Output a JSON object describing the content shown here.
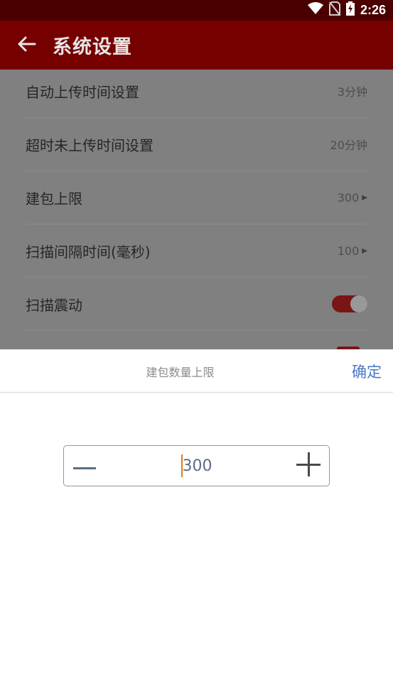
{
  "status_bar": {
    "time": "2:26",
    "icons": [
      "wifi-icon",
      "no-sim-icon",
      "battery-charging-icon"
    ]
  },
  "app_bar": {
    "back_icon": "arrow-left-icon",
    "title": "系统设置"
  },
  "settings": {
    "items": [
      {
        "label": "自动上传时间设置",
        "value": "3分钟",
        "has_arrow": false
      },
      {
        "label": "超时未上传时间设置",
        "value": "20分钟",
        "has_arrow": false
      },
      {
        "label": "建包上限",
        "value": "300",
        "has_arrow": true
      },
      {
        "label": "扫描间隔时间(毫秒)",
        "value": "100",
        "has_arrow": true
      },
      {
        "label": "扫描震动",
        "toggle": true
      }
    ]
  },
  "dialog": {
    "title": "建包数量上限",
    "confirm_label": "确定",
    "stepper": {
      "value": "300",
      "decrement_icon": "minus-icon",
      "increment_icon": "plus-icon"
    }
  },
  "colors": {
    "status_bar_bg": "#4a0000",
    "app_bar_bg": "#760000",
    "overlay_bg": "#808080",
    "accent_blue": "#4a76c9",
    "toggle_on": "#7a1515",
    "caret": "#e07b1a"
  }
}
